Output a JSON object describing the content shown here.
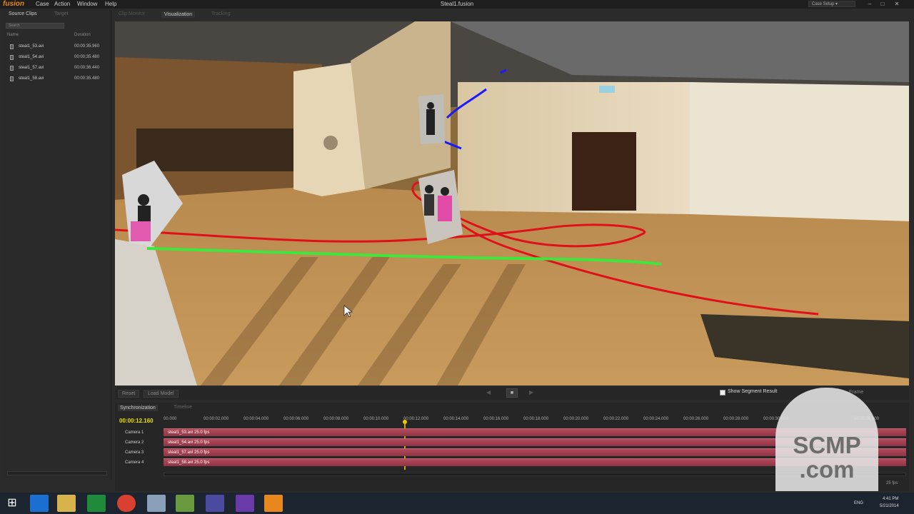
{
  "titlebar": {
    "logo": "fusion",
    "menu": [
      "Case",
      "Action",
      "Window",
      "Help"
    ],
    "window_title": "Steal1.fusion",
    "case_setup": "Case Setup"
  },
  "left_panel": {
    "tabs": [
      "Source Clips",
      "Target"
    ],
    "search_placeholder": "Search",
    "columns": [
      "Name",
      "Duration"
    ],
    "clips": [
      {
        "name": "steal1_53.avi",
        "duration": "00:00:35.960"
      },
      {
        "name": "steal1_54.avi",
        "duration": "00:00:35.480"
      },
      {
        "name": "steal1_57.avi",
        "duration": "00:00:36.440"
      },
      {
        "name": "steal1_58.avi",
        "duration": "00:00:35.480"
      }
    ]
  },
  "view_tabs": [
    "Clip Monitor",
    "Visualization",
    "Tracking"
  ],
  "controls": {
    "reset": "Reset",
    "load_model": "Load Model",
    "show_segment": "Show Segment Result",
    "frame": "Frame"
  },
  "timeline": {
    "tabs": [
      "Synchronization",
      "Timeline"
    ],
    "current_time": "00:00:12.160",
    "ticks": [
      "00.000",
      "00:00:02.000",
      "00:00:04.000",
      "00:00:06.000",
      "00:00:08.000",
      "00:00:10.000",
      "00:00:12.000",
      "00:00:14.000",
      "00:00:16.000",
      "00:00:18.000",
      "00:00:20.000",
      "00:00:22.000",
      "00:00:24.000",
      "00:00:26.000",
      "00:00:28.000",
      "00:00:30.000",
      "00:00:36.000"
    ],
    "cameras": [
      {
        "label": "Camera 1",
        "clip": "steal1_53.avi  25.0 fps"
      },
      {
        "label": "Camera 2",
        "clip": "steal1_54.avi  25.0 fps"
      },
      {
        "label": "Camera 3",
        "clip": "steal1_57.avi  25.0 fps"
      },
      {
        "label": "Camera 4",
        "clip": "steal1_58.avi  25.0 fps"
      }
    ],
    "framerate": "25 fps"
  },
  "watermark": {
    "line1": "SCMP",
    "line2": ".com"
  },
  "taskbar": {
    "lang": "ENG",
    "time": "4:41 PM",
    "date": "5/21/2014"
  },
  "colors": {
    "accent": "#e8871e",
    "track_red": "#e0101a",
    "track_green": "#3ee63e",
    "track_blue": "#1a1aff",
    "timeline_bar": "#b24a5a"
  }
}
